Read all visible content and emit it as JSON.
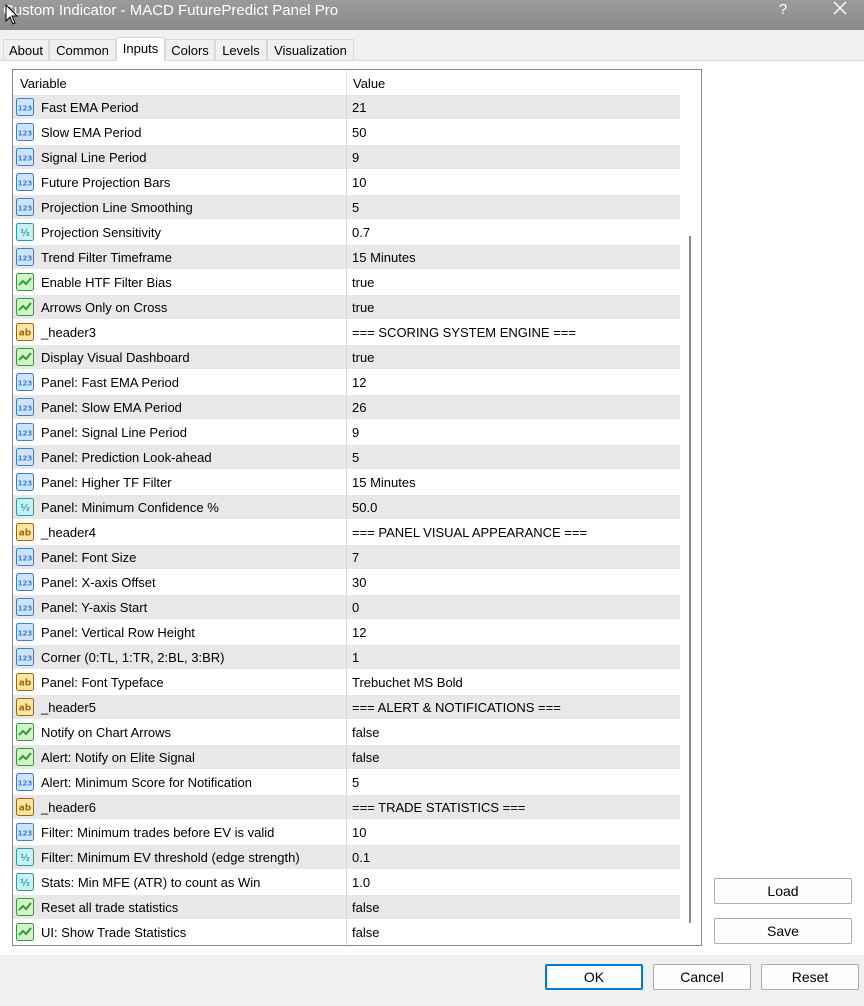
{
  "window": {
    "title": "Custom Indicator - MACD FuturePredict Panel Pro",
    "help": "?"
  },
  "tabs": [
    "About",
    "Common",
    "Inputs",
    "Colors",
    "Levels",
    "Visualization"
  ],
  "grid": {
    "col_variable": "Variable",
    "col_value": "Value"
  },
  "rows": [
    {
      "type": "int",
      "name": "Fast EMA Period",
      "value": "21"
    },
    {
      "type": "int",
      "name": "Slow EMA Period",
      "value": "50"
    },
    {
      "type": "int",
      "name": "Signal Line Period",
      "value": "9"
    },
    {
      "type": "int",
      "name": "Future Projection Bars",
      "value": "10"
    },
    {
      "type": "int",
      "name": "Projection Line Smoothing",
      "value": "5"
    },
    {
      "type": "dbl",
      "name": "Projection Sensitivity",
      "value": "0.7"
    },
    {
      "type": "int",
      "name": "Trend Filter Timeframe",
      "value": "15 Minutes"
    },
    {
      "type": "bool",
      "name": "Enable HTF Filter Bias",
      "value": "true"
    },
    {
      "type": "bool",
      "name": "Arrows Only on Cross",
      "value": "true"
    },
    {
      "type": "str",
      "name": "_header3",
      "value": "=== SCORING SYSTEM ENGINE ==="
    },
    {
      "type": "bool",
      "name": "Display Visual Dashboard",
      "value": "true"
    },
    {
      "type": "int",
      "name": "Panel: Fast EMA Period",
      "value": "12"
    },
    {
      "type": "int",
      "name": "Panel: Slow EMA Period",
      "value": "26"
    },
    {
      "type": "int",
      "name": "Panel: Signal Line Period",
      "value": "9"
    },
    {
      "type": "int",
      "name": "Panel: Prediction Look-ahead",
      "value": "5"
    },
    {
      "type": "int",
      "name": "Panel: Higher TF Filter",
      "value": "15 Minutes"
    },
    {
      "type": "dbl",
      "name": "Panel: Minimum Confidence %",
      "value": "50.0"
    },
    {
      "type": "str",
      "name": "_header4",
      "value": "=== PANEL VISUAL APPEARANCE ==="
    },
    {
      "type": "int",
      "name": "Panel: Font Size",
      "value": "7"
    },
    {
      "type": "int",
      "name": "Panel: X-axis Offset",
      "value": "30"
    },
    {
      "type": "int",
      "name": "Panel: Y-axis Start",
      "value": "0"
    },
    {
      "type": "int",
      "name": "Panel: Vertical Row Height",
      "value": "12"
    },
    {
      "type": "int",
      "name": "Corner (0:TL, 1:TR, 2:BL, 3:BR)",
      "value": "1"
    },
    {
      "type": "str",
      "name": "Panel: Font Typeface",
      "value": "Trebuchet MS Bold"
    },
    {
      "type": "str",
      "name": "_header5",
      "value": "=== ALERT & NOTIFICATIONS ==="
    },
    {
      "type": "bool",
      "name": "Notify on Chart Arrows",
      "value": "false"
    },
    {
      "type": "bool",
      "name": "Alert: Notify on Elite Signal",
      "value": "false"
    },
    {
      "type": "int",
      "name": "Alert: Minimum Score for Notification",
      "value": "5"
    },
    {
      "type": "str",
      "name": "_header6",
      "value": "=== TRADE STATISTICS ==="
    },
    {
      "type": "int",
      "name": "Filter: Minimum trades before EV is valid",
      "value": "10"
    },
    {
      "type": "dbl",
      "name": "Filter: Minimum EV threshold (edge strength)",
      "value": "0.1"
    },
    {
      "type": "dbl",
      "name": "Stats: Min MFE (ATR) to count as Win",
      "value": "1.0"
    },
    {
      "type": "bool",
      "name": "Reset all trade statistics",
      "value": "false"
    },
    {
      "type": "bool",
      "name": "UI: Show Trade Statistics",
      "value": "false"
    }
  ],
  "icons": {
    "int": {
      "glyph": "123",
      "color": "#3b7fd0",
      "bg": "#cfe3fb"
    },
    "dbl": {
      "glyph": "½",
      "color": "#2a9aa8",
      "bg": "#c9f0f2"
    },
    "bool": {
      "glyph": "✓",
      "color": "#2f9e2f",
      "bg": "#d4f2cc"
    },
    "str": {
      "glyph": "ab",
      "color": "#a06a00",
      "bg": "#fbe6a8"
    }
  },
  "side_buttons": {
    "load": "Load",
    "save": "Save"
  },
  "footer": {
    "ok": "OK",
    "cancel": "Cancel",
    "reset": "Reset"
  }
}
